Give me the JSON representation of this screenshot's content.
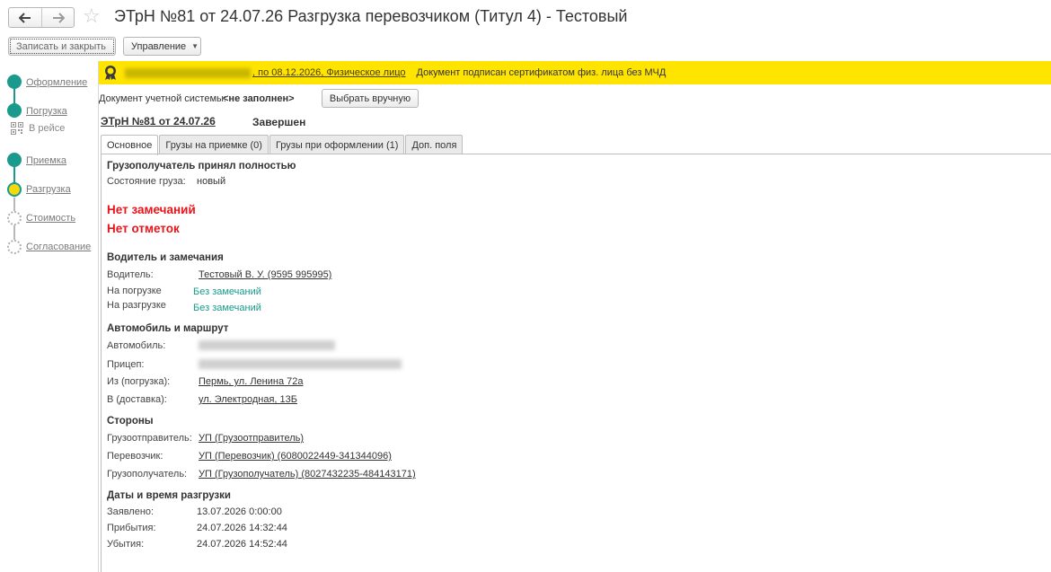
{
  "header": {
    "title": "ЭТрН №81 от 24.07.26 Разгрузка перевозчиком (Титул 4) - Тестовый",
    "save_close": "Записать и закрыть",
    "manage": "Управление"
  },
  "stepper": {
    "steps": [
      {
        "label": "Оформление",
        "state": "done"
      },
      {
        "label": "Погрузка",
        "state": "done"
      },
      {
        "label": "Приемка",
        "state": "done"
      },
      {
        "label": "Разгрузка",
        "state": "current"
      },
      {
        "label": "Стоимость",
        "state": "pending"
      },
      {
        "label": "Согласование",
        "state": "pending"
      }
    ],
    "substep": "В рейсе"
  },
  "banner": {
    "signer_suffix": ", по 08.12.2026, Физическое лицо",
    "text": "Документ подписан сертификатом физ. лица без МЧД",
    "color": "#ffe400"
  },
  "account": {
    "label": "Документ учетной системы:",
    "value": "<не заполнен>",
    "select_button": "Выбрать вручную"
  },
  "doc": {
    "link": "ЭТрН №81 от 24.07.26",
    "status": "Завершен"
  },
  "tabs": [
    {
      "label": "Основное",
      "active": true
    },
    {
      "label": "Грузы на приемке (0)",
      "active": false
    },
    {
      "label": "Грузы при оформлении (1)",
      "active": false
    },
    {
      "label": "Доп. поля",
      "active": false
    }
  ],
  "main": {
    "accept_heading": "Грузополучатель принял полностью",
    "cargo_state_label": "Состояние груза:",
    "cargo_state_value": "новый",
    "no_remarks": "Нет замечаний",
    "no_marks": "Нет отметок",
    "driver_section": {
      "heading": "Водитель и замечания",
      "driver_label": "Водитель:",
      "driver_value": "Тестовый В. У. (9595 995995)",
      "loading_label": "На погрузке",
      "loading_value": "Без замечаний",
      "unloading_label": "На разгрузке",
      "unloading_value": "Без замечаний"
    },
    "vehicle_section": {
      "heading": "Автомобиль и маршрут",
      "car_label": "Автомобиль:",
      "trailer_label": "Прицеп:",
      "from_label": "Из (погрузка):",
      "from_value": "Пермь, ул. Ленина 72а",
      "to_label": "В (доставка):",
      "to_value": "ул. Электродная, 13Б"
    },
    "parties_section": {
      "heading": "Стороны",
      "shipper_label": "Грузоотправитель:",
      "shipper_value": "УП (Грузоотправитель)",
      "carrier_label": "Перевозчик:",
      "carrier_value": "УП (Перевозчик) (6080022449-341344096)",
      "consignee_label": "Грузополучатель:",
      "consignee_value": "УП (Грузополучатель) (8027432235-484143171)"
    },
    "dates_section": {
      "heading": "Даты и время разгрузки",
      "declared_label": "Заявлено:",
      "declared_value": "13.07.2026 0:00:00",
      "arrival_label": "Прибытия:",
      "arrival_value": "24.07.2026 14:32:44",
      "departure_label": "Убытия:",
      "departure_value": "24.07.2026 14:52:44"
    }
  }
}
